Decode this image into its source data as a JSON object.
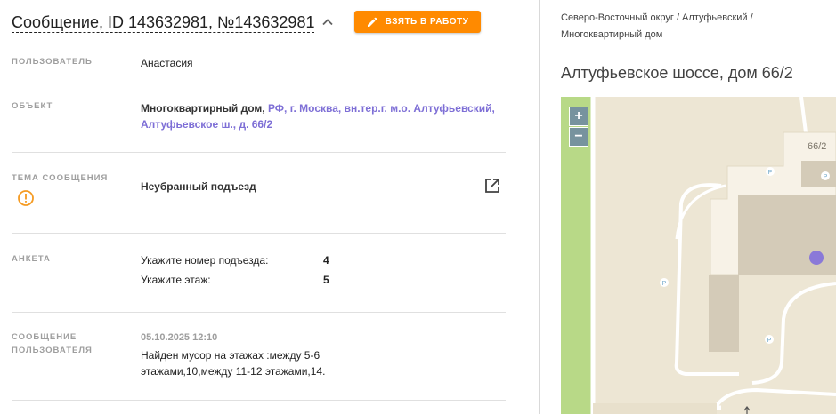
{
  "header": {
    "title": "Сообщение, ID 143632981, №143632981",
    "take_button": "ВЗЯТЬ В РАБОТУ"
  },
  "fields": {
    "user": {
      "label": "ПОЛЬЗОВАТЕЛЬ",
      "value": "Анастасия"
    },
    "object": {
      "label": "ОБЪЕКТ",
      "type": "Многоквартирный дом,",
      "address_line1": "РФ, г. Москва, вн.тер.г. м.о. Алтуфьевский,",
      "address_line2": "Алтуфьевское ш., д. 66/2"
    },
    "topic": {
      "label": "ТЕМА СООБЩЕНИЯ",
      "value": "Неубранный подъезд"
    },
    "survey": {
      "label": "АНКЕТА",
      "rows": [
        {
          "q": "Укажите номер подъезда:",
          "a": "4"
        },
        {
          "q": "Укажите этаж:",
          "a": "5"
        }
      ]
    },
    "message": {
      "label_line1": "СООБЩЕНИЕ",
      "label_line2": "ПОЛЬЗОВАТЕЛЯ",
      "date": "05.10.2025 12:10",
      "text_line1": "Найден мусор на этажах :между 5-6",
      "text_line2": "этажами,10,между 11-12 этажами,14."
    }
  },
  "right": {
    "breadcrumb_line1": "Северо-Восточный округ / Алтуфьевский /",
    "breadcrumb_line2": "Многоквартирный дом",
    "address_title": "Алтуфьевское шоссе, дом 66/2",
    "map": {
      "zoom_in": "+",
      "zoom_out": "−",
      "house_number": "66/2",
      "parking_label": "P",
      "marker_color": "#8a79d8"
    }
  },
  "colors": {
    "accent": "#ff8a00",
    "link": "#7e6fd6",
    "warning": "#f59b23"
  }
}
